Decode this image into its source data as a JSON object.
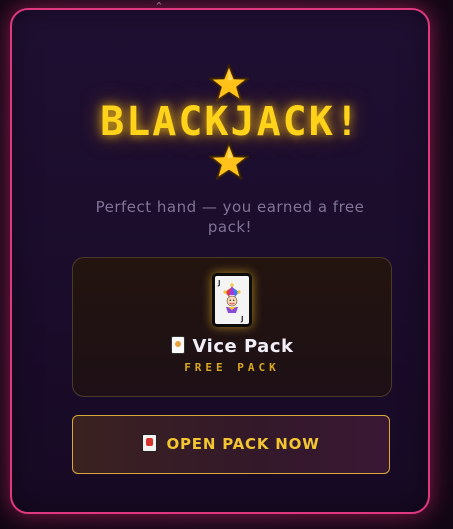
{
  "modal": {
    "title": "BLACKJACK!",
    "subtitle": "Perfect hand — you earned a free pack!",
    "accent_color": "#e0387e",
    "title_color": "#ffd31a"
  },
  "decorations": {
    "top_star_icon": "star-icon",
    "bottom_star_icon": "star-icon",
    "chevron_icon": "chevron-up-icon"
  },
  "pack": {
    "art_icon": "joker-card-icon",
    "name_icon": "playing-card-icon",
    "name": "Vice Pack",
    "tag": "FREE PACK"
  },
  "actions": {
    "open_label": "OPEN PACK NOW",
    "open_icon": "flower-card-icon"
  }
}
